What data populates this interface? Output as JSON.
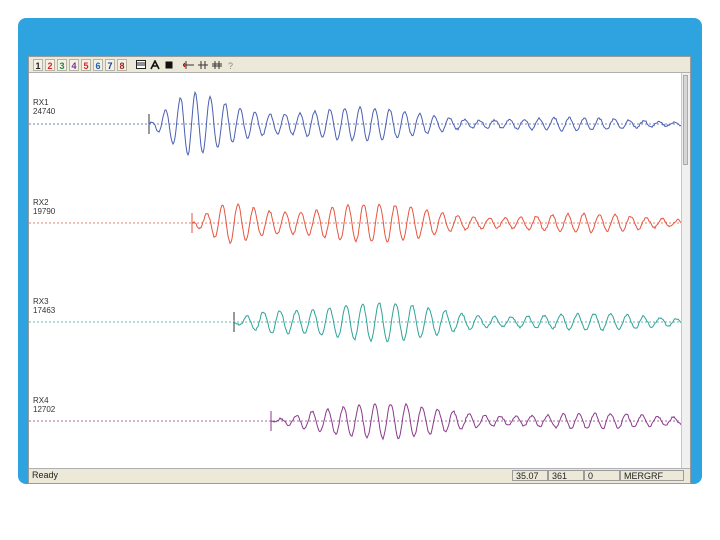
{
  "toolbar": {
    "channel_buttons": [
      {
        "label": "1",
        "color": "#222222"
      },
      {
        "label": "2",
        "color": "#e0201f"
      },
      {
        "label": "3",
        "color": "#1a8a3a"
      },
      {
        "label": "4",
        "color": "#7a2e9a"
      },
      {
        "label": "5",
        "color": "#e0201f"
      },
      {
        "label": "6",
        "color": "#1a5fb4"
      },
      {
        "label": "7",
        "color": "#1a3a8a"
      },
      {
        "label": "8",
        "color": "#a0201f"
      }
    ],
    "tool_icons": [
      "display-icon",
      "cursor-a-icon",
      "stop-icon",
      "zoom-in-icon",
      "marker-icon",
      "marker-double-icon",
      "help-icon"
    ]
  },
  "channels": [
    {
      "name": "RX1",
      "value": "24740",
      "color": "#4a5fb0"
    },
    {
      "name": "RX2",
      "value": "19790",
      "color": "#e5553f"
    },
    {
      "name": "RX3",
      "value": "17463",
      "color": "#2fa398"
    },
    {
      "name": "RX4",
      "value": "12702",
      "color": "#8a3a8a"
    }
  ],
  "status": {
    "ready": "Ready",
    "cells": [
      "35.07",
      "361",
      "0",
      "MERGRF"
    ]
  }
}
